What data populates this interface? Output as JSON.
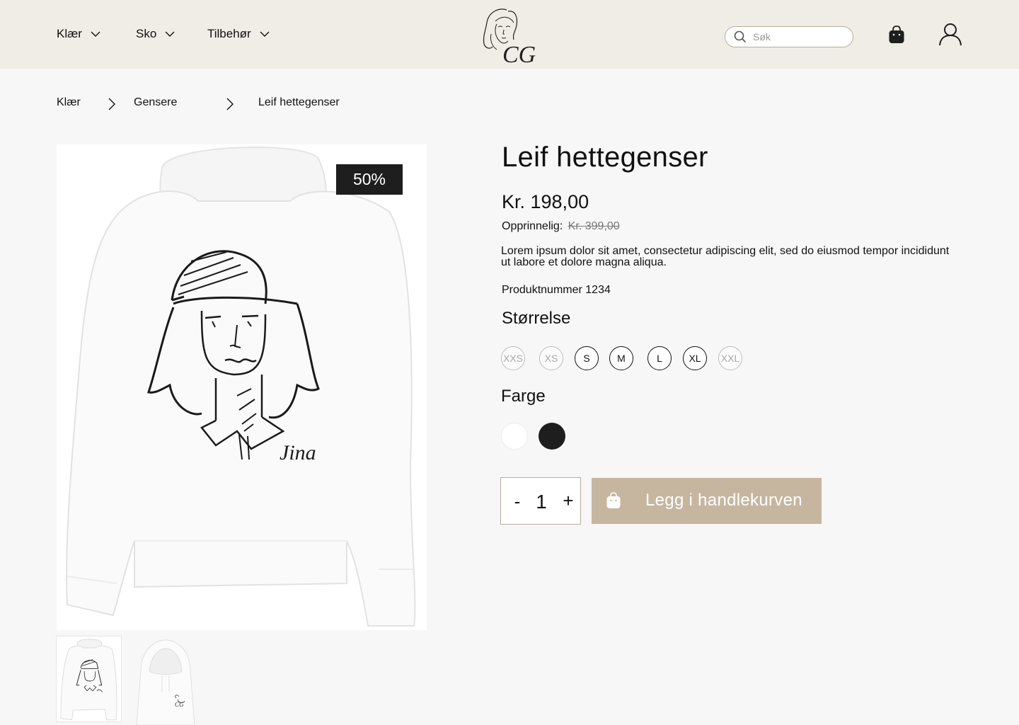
{
  "colors": {
    "header_bg": "#f0ece6",
    "page_bg": "#f7f7f7",
    "accent": "#c6b6a0",
    "badge_bg": "#1e1e1e"
  },
  "header": {
    "nav": [
      {
        "label": "Klær",
        "icon": "chevron-down-icon"
      },
      {
        "label": "Sko",
        "icon": "chevron-down-icon"
      },
      {
        "label": "Tilbehør",
        "icon": "chevron-down-icon"
      }
    ],
    "logo_text": "CG",
    "search": {
      "placeholder": "Søk",
      "icon": "search-icon"
    },
    "cart_icon": "shopping-bag-icon",
    "account_icon": "user-icon"
  },
  "breadcrumb": [
    {
      "label": "Klær"
    },
    {
      "label": "Gensere"
    },
    {
      "label": "Leif hettegenser"
    }
  ],
  "product": {
    "title": "Leif hettegenser",
    "price": "Kr. 198,00",
    "original_label": "Opprinnelig:",
    "original_price": "Kr. 399,00",
    "discount": "50%",
    "description": "Lorem ipsum dolor sit amet, consectetur adipiscing elit, sed do eiusmod tempor incididunt ut labore et dolore magna aliqua.",
    "product_number": "Produktnummer 1234",
    "image_signature": "Jina",
    "size_heading": "Størrelse",
    "sizes": [
      {
        "label": "XXS",
        "available": false
      },
      {
        "label": "XS",
        "available": false
      },
      {
        "label": "S",
        "available": true
      },
      {
        "label": "M",
        "available": true
      },
      {
        "label": "L",
        "available": true
      },
      {
        "label": "XL",
        "available": true
      },
      {
        "label": "XXL",
        "available": false
      }
    ],
    "color_heading": "Farge",
    "colors": [
      {
        "name": "white",
        "hex": "#ffffff"
      },
      {
        "name": "black",
        "hex": "#1e1e1e"
      }
    ]
  },
  "cart": {
    "qty_minus": "-",
    "quantity": "1",
    "qty_plus": "+",
    "add_label": "Legg i handlekurven",
    "add_icon": "shopping-bag-icon"
  }
}
